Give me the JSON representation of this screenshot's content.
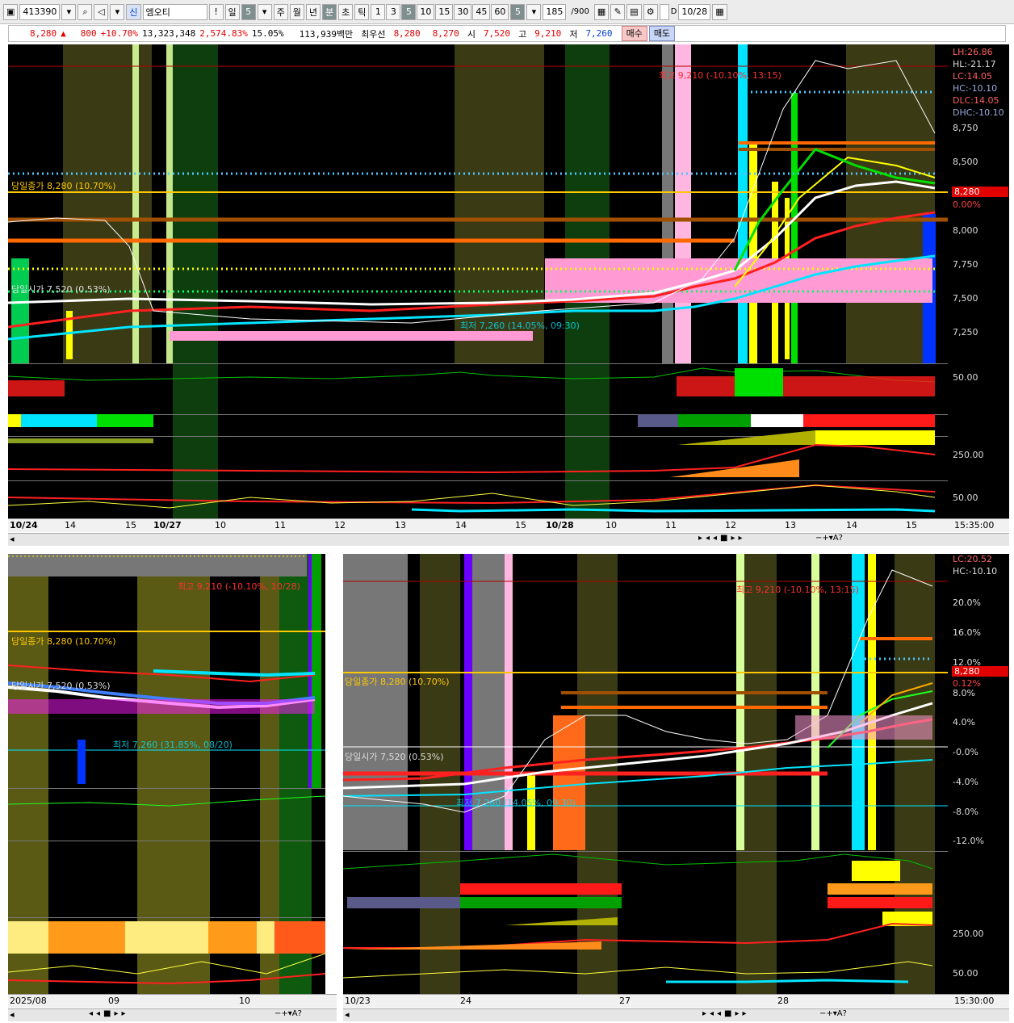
{
  "toolbar": {
    "code": "413390",
    "badge": "신",
    "name": "엠오티",
    "period_day": "일",
    "period_day_num": "5",
    "period_week": "주",
    "period_month": "월",
    "period_year": "년",
    "period_min": "분",
    "period_sec": "초",
    "period_tick": "틱",
    "intervals": [
      "1",
      "3",
      "5",
      "10",
      "15",
      "30",
      "45",
      "60"
    ],
    "interval_sel": "5",
    "count": "185",
    "count_total": "/900",
    "date": "10/28",
    "d_label": "D"
  },
  "quote": {
    "price": "8,280",
    "arrow": "▲",
    "change": "800",
    "change_pct": "+10.70%",
    "volume": "13,323,348",
    "vol_ratio": "2,574.83%",
    "turnover": "15.05%",
    "amount": "113,939백만",
    "best_label": "최우선",
    "ask": "8,280",
    "bid": "8,270",
    "open_label": "시",
    "open": "7,520",
    "high_label": "고",
    "high": "9,210",
    "low_label": "저",
    "low": "7,260",
    "buy": "매수",
    "sell": "매도"
  },
  "top": {
    "yaxis": [
      "LH:26.86",
      "HL:-21.17",
      "LC:14.05",
      "HC:-10.10",
      "DLC:14.05",
      "DHC:-10.10",
      "8,750",
      "8,500",
      "8,280",
      "0.00%",
      "8,000",
      "7,750",
      "7,500",
      "7,250"
    ],
    "ind1": "50.00",
    "ind2": "250.00",
    "ind3": "50.00",
    "high_note": "최고 9,210 (-10.10%, 13:15)",
    "close_note": "당일종가 8,280 (10.70%)",
    "open_note": "당일시가 7,520 (0.53%)",
    "low_note": "최저 7,260 (14.05%, 09:30)",
    "xaxis": [
      "10/24",
      "14",
      "15",
      "10/27",
      "10",
      "11",
      "12",
      "13",
      "14",
      "15",
      "10/28",
      "10",
      "11",
      "12",
      "13",
      "14",
      "15"
    ],
    "time": "15:35:00"
  },
  "bl": {
    "high_note": "최고 9,210 (-10.10%, 10/28)",
    "close_note": "당일종가 8,280 (10.70%)",
    "open_note": "당일시가 7,520 (0.53%)",
    "low_note": "최저 7,260 (31.85%, 08/20)",
    "xaxis": [
      "2025/08",
      "09",
      "10"
    ]
  },
  "br": {
    "yaxis": [
      "LC:20.52",
      "HC:-10.10",
      "20.0%",
      "16.0%",
      "12.0%",
      "8,280",
      "0.12%",
      "8.0%",
      "4.0%",
      "-0.0%",
      "-4.0%",
      "-8.0%",
      "-12.0%"
    ],
    "ind2": "250.00",
    "ind3": "50.00",
    "high_note": "최고 9,210 (-10.10%, 13:15)",
    "close_note": "당일종가 8,280 (10.70%)",
    "open_note": "당일시가 7,520 (0.53%)",
    "low_note": "최저 7,260 (14.05%, 09:30)",
    "xaxis": [
      "10/23",
      "24",
      "27",
      "28"
    ],
    "time": "15:30:00"
  },
  "colors": {
    "up": "#ff2020",
    "down": "#ffffff",
    "ma": "#ffd400",
    "accent_green": "#00e000",
    "cyan": "#00e5ff",
    "pink": "#ff9ad5"
  }
}
